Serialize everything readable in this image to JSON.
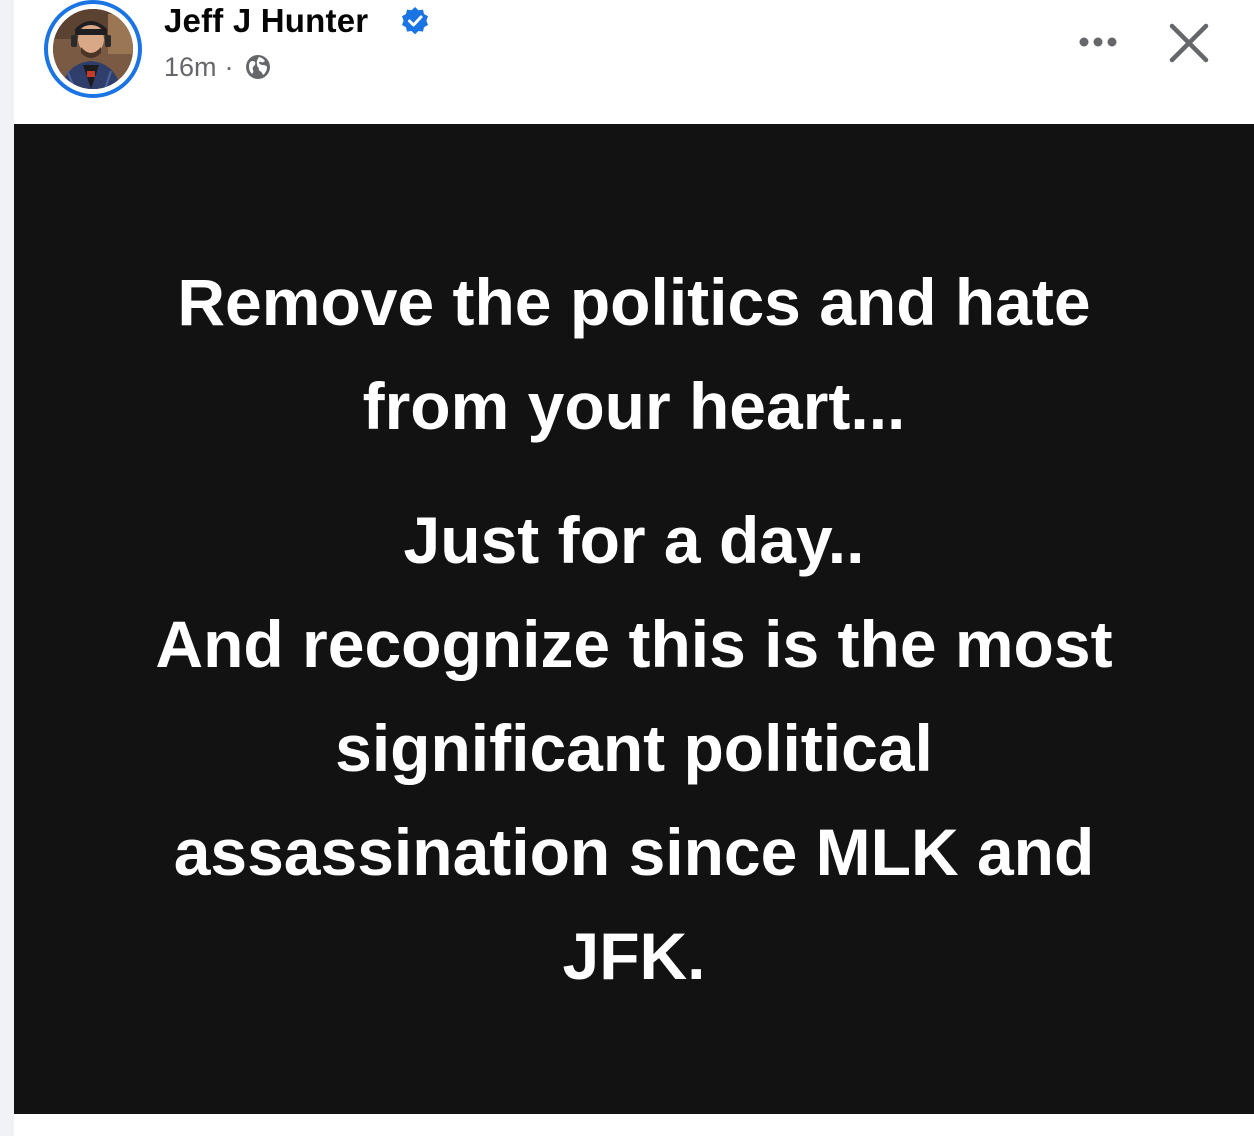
{
  "post": {
    "author": "Jeff J Hunter",
    "timestamp": "16m",
    "separator": "·",
    "verified": true,
    "privacy_icon": "globe-icon",
    "actions": {
      "more_icon": "more-dots-icon",
      "close_icon": "close-icon"
    },
    "text_lines_block1": [
      "Remove the politics and hate",
      "from your heart..."
    ],
    "text_lines_block2": [
      "Just for a day..",
      "And recognize this is the most",
      "significant political",
      "assassination since MLK and",
      "JFK."
    ],
    "background_color": "#121212",
    "text_color": "#ffffff"
  },
  "colors": {
    "accent": "#1b74e4",
    "name_text": "#050505",
    "meta_text": "#65676b"
  }
}
